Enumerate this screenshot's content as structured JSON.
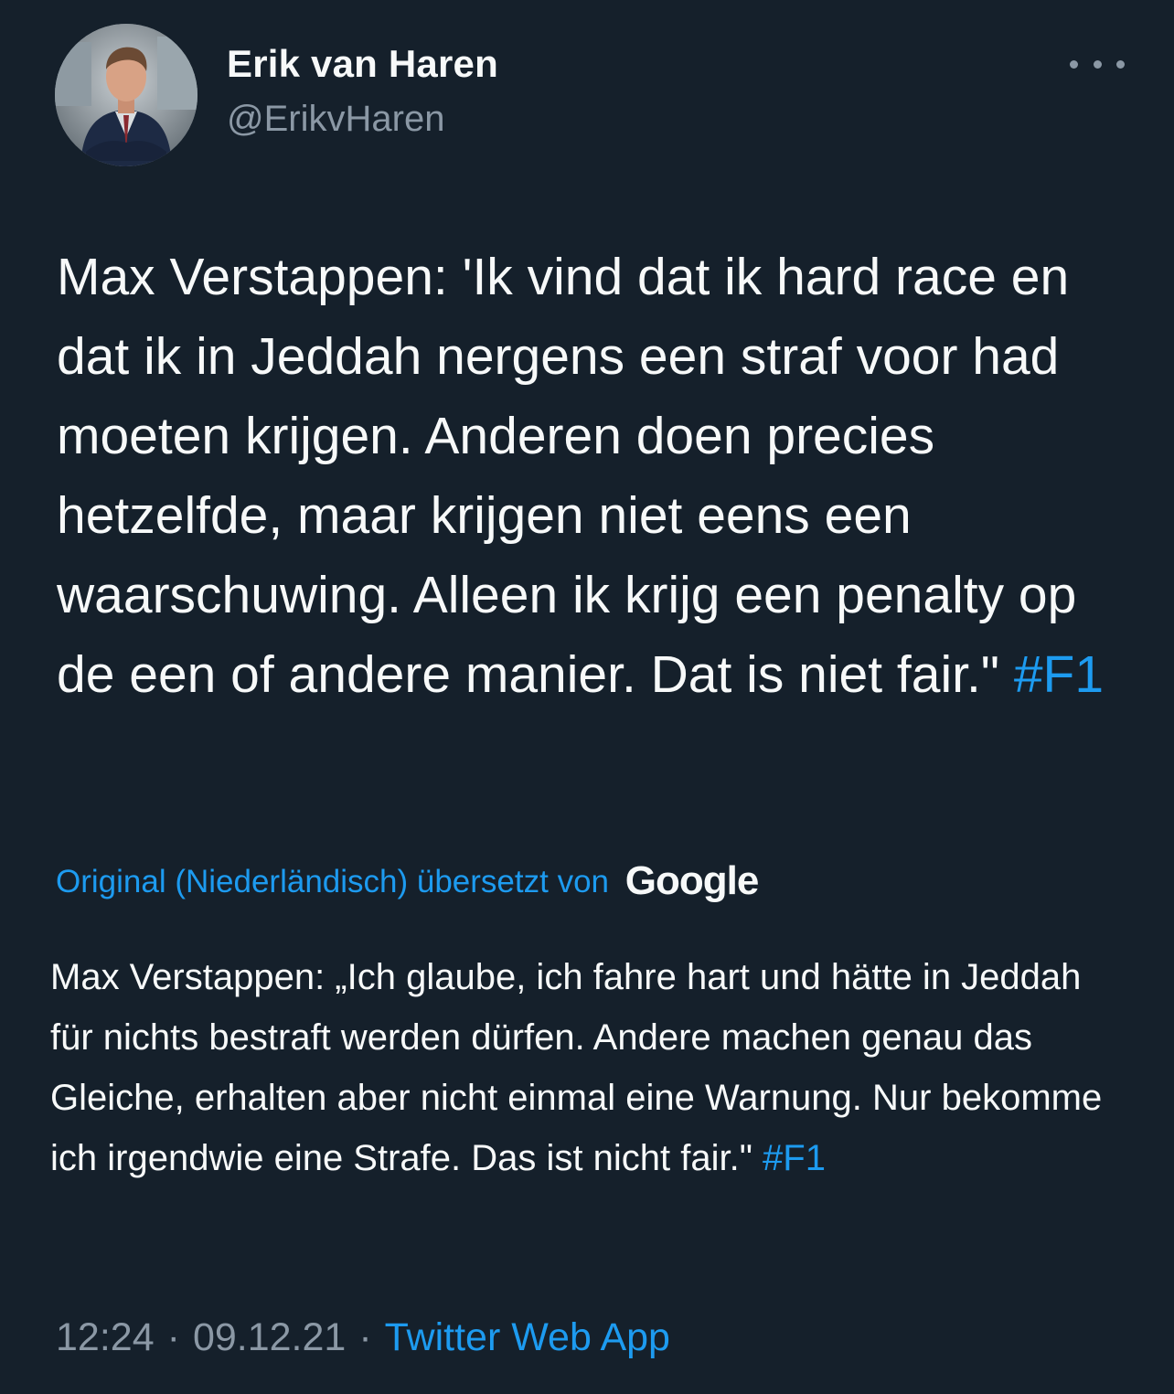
{
  "author": {
    "name": "Erik van Haren",
    "handle": "@ErikvHaren"
  },
  "tweet": {
    "text": "Max Verstappen: 'Ik vind dat ik hard race en dat ik in Jeddah nergens een straf voor had moeten krijgen. Anderen doen precies hetzelfde, maar krijgen niet eens een waarschuwing. Alleen ik krijg een penalty op de een of andere manier. Dat is niet fair.\"",
    "hashtag": "#F1"
  },
  "translation": {
    "credit_label": "Original (Niederländisch) übersetzt von",
    "provider": "Google",
    "text": "Max Verstappen: „Ich glaube, ich fahre hart und hätte in Jeddah für nichts bestraft werden dürfen. Andere machen genau das Gleiche, erhalten aber nicht einmal eine Warnung. Nur bekomme ich irgendwie eine Strafe. Das ist nicht fair.\"",
    "hashtag": "#F1"
  },
  "meta": {
    "time": "12:24",
    "separator": "·",
    "date": "09.12.21",
    "source": "Twitter Web App"
  },
  "icons": {
    "more": "more-horizontal-icon"
  },
  "colors": {
    "background": "#15202b",
    "text": "#f7f9f9",
    "secondary": "#8b98a5",
    "accent": "#1d9bf0"
  }
}
